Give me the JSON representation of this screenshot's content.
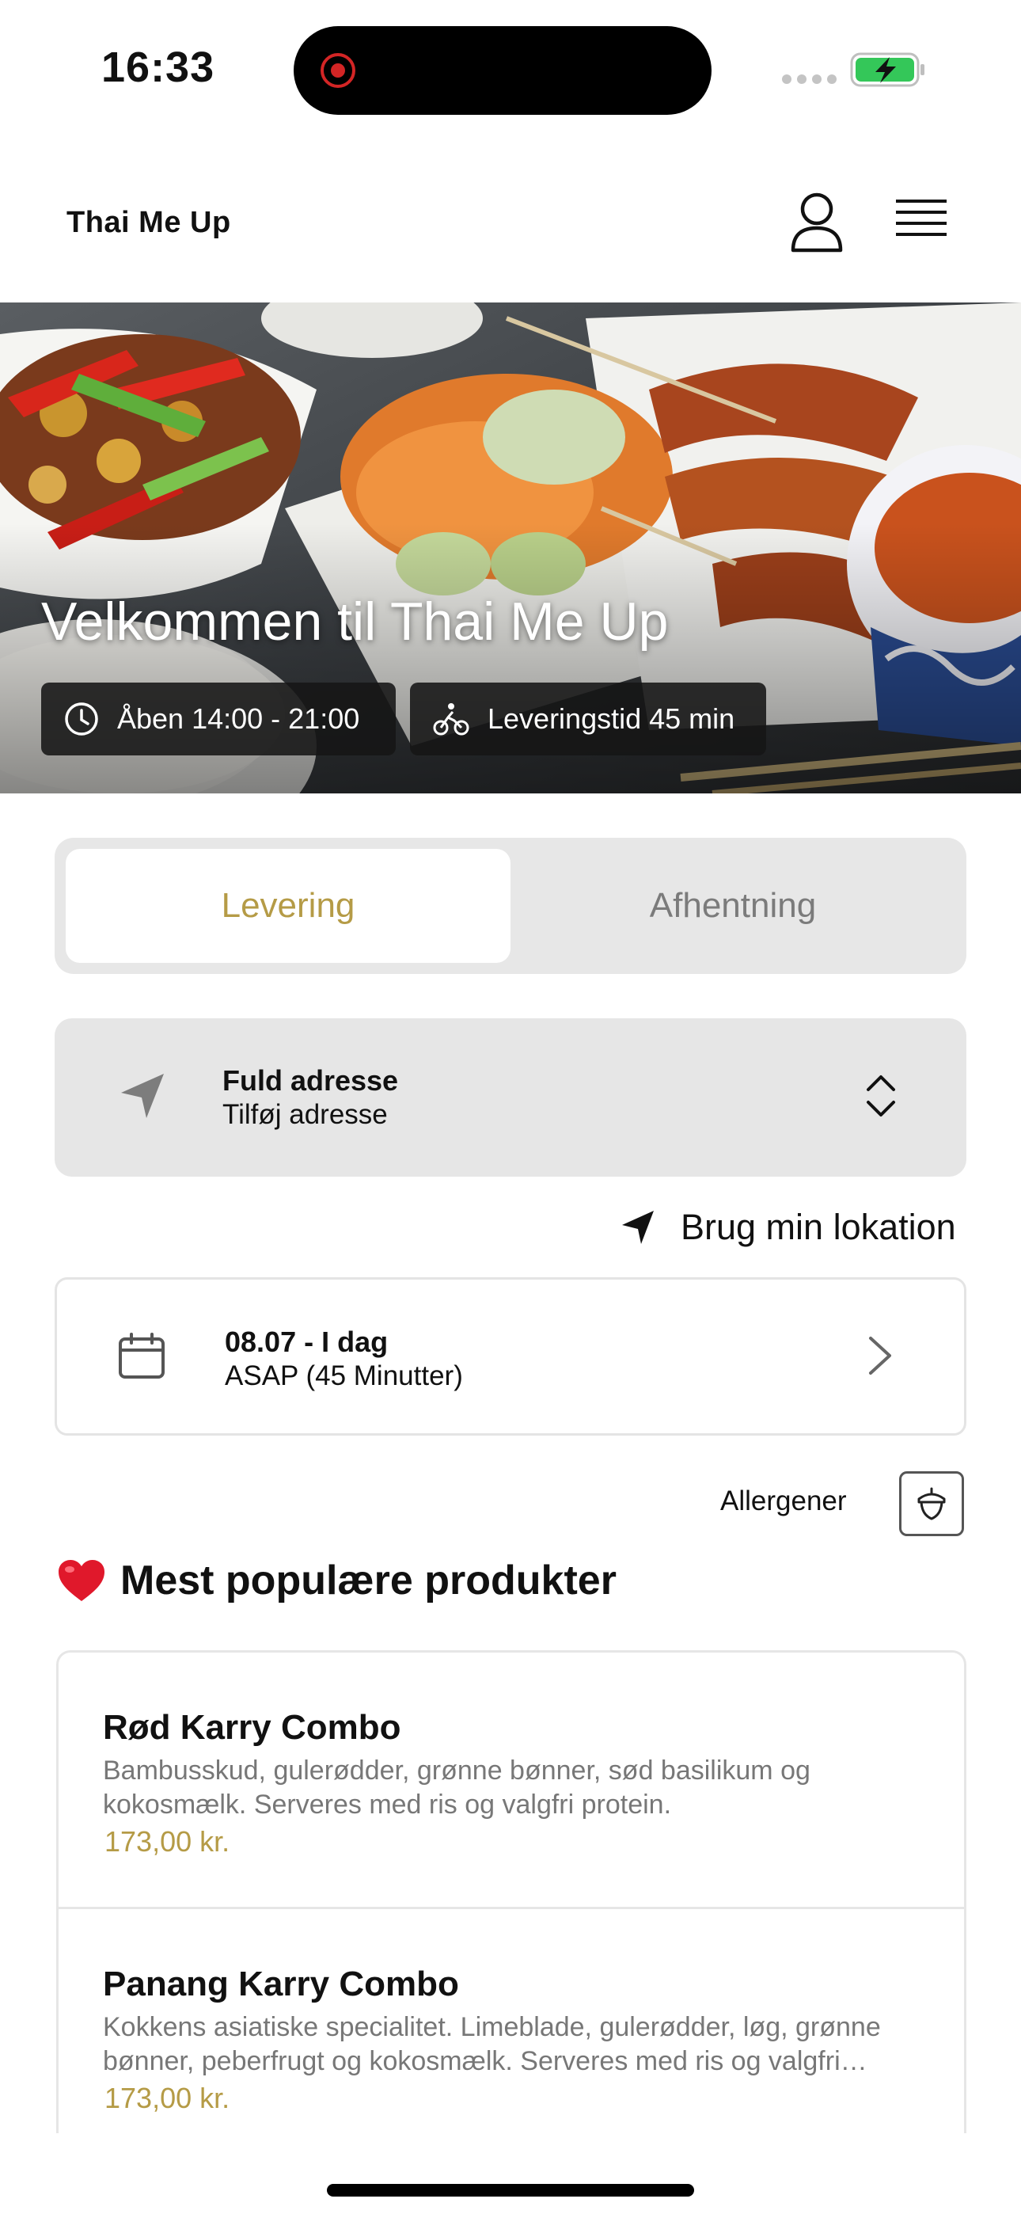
{
  "status_bar": {
    "time": "16:33",
    "battery_icon": "battery-charging-icon",
    "accent_battery": "#34c759"
  },
  "header": {
    "brand": "Thai Me Up",
    "profile_icon": "user-icon",
    "menu_icon": "hamburger-menu-icon"
  },
  "hero": {
    "title": "Velkommen til Thai Me Up",
    "open_hours": "Åben 14:00 - 21:00",
    "delivery_time": "Leveringstid 45 min"
  },
  "mode_toggle": {
    "selected": "Levering",
    "options": [
      "Levering",
      "Afhentning"
    ]
  },
  "address": {
    "title": "Fuld adresse",
    "placeholder": "Tilføj adresse"
  },
  "use_location": "Brug min lokation",
  "date": {
    "title": "08.07 - I dag",
    "subtitle": "ASAP (45 Minutter)"
  },
  "allergens": {
    "label": "Allergener",
    "icon": "acorn-icon"
  },
  "section": {
    "title": "Mest populære produkter",
    "icon": "heart-icon"
  },
  "products": [
    {
      "name": "Rød Karry Combo",
      "description": "Bambusskud, gulerødder, grønne bønner, sød basilikum og kokosmælk. Serveres med ris og valgfri protein.",
      "price": "173,00 kr."
    },
    {
      "name": "Panang Karry Combo",
      "description": "Kokkens asiatiske specialitet. Limeblade, gulerødder, løg, grønne bønner, peberfrugt og kokosmælk. Serveres med ris og valgfri protein.",
      "price": "173,00 kr."
    }
  ],
  "colors": {
    "accent_gold": "#b59b46",
    "card_grey": "#e6e6e6",
    "chip_dark": "#161616"
  }
}
